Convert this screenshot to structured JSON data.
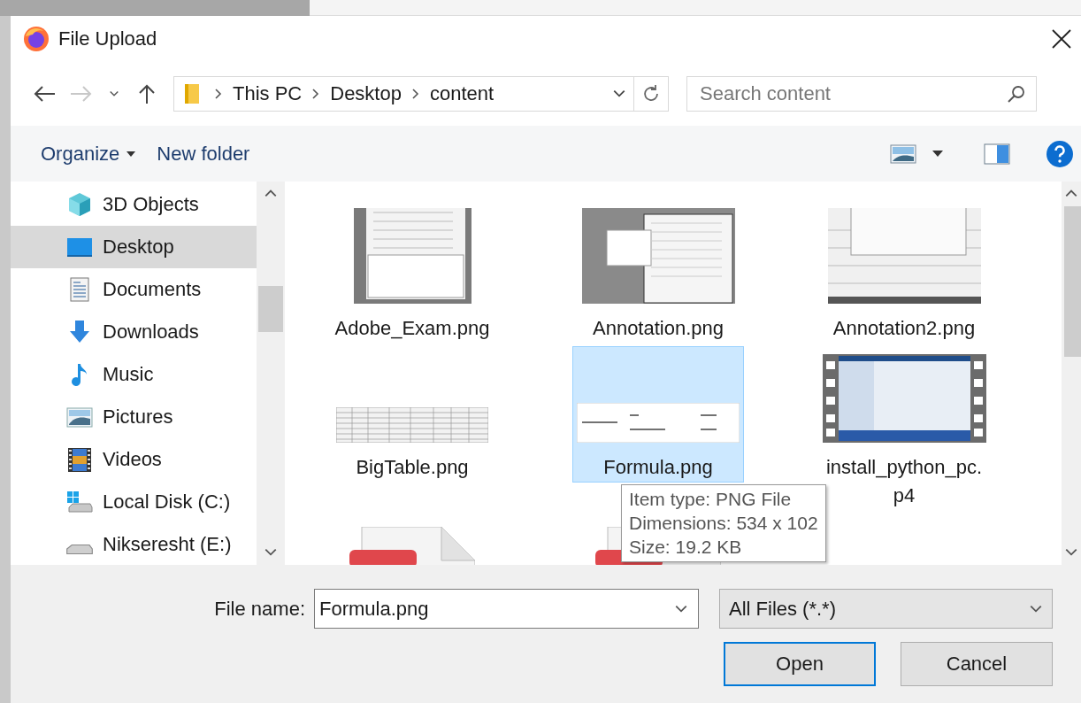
{
  "window": {
    "title": "File Upload"
  },
  "navigation": {
    "back_enabled": true,
    "forward_enabled": false,
    "path": [
      "This PC",
      "Desktop",
      "content"
    ],
    "search": {
      "placeholder": "Search content"
    }
  },
  "toolbar": {
    "organize": "Organize",
    "new_folder": "New folder"
  },
  "sidebar": {
    "items": [
      {
        "label": "3D Objects",
        "kind": "cube",
        "selected": false
      },
      {
        "label": "Desktop",
        "kind": "desktop",
        "selected": true
      },
      {
        "label": "Documents",
        "kind": "documents",
        "selected": false
      },
      {
        "label": "Downloads",
        "kind": "downloads",
        "selected": false
      },
      {
        "label": "Music",
        "kind": "music",
        "selected": false
      },
      {
        "label": "Pictures",
        "kind": "pictures",
        "selected": false
      },
      {
        "label": "Videos",
        "kind": "videos",
        "selected": false
      },
      {
        "label": "Local Disk (C:)",
        "kind": "system-drive",
        "selected": false
      },
      {
        "label": "Nikseresht (E:)",
        "kind": "drive",
        "selected": false
      }
    ]
  },
  "files": [
    {
      "name_lines": [
        "Adobe_Exam.png"
      ],
      "kind": "screenshot",
      "selected": false
    },
    {
      "name_lines": [
        "Annotation.png"
      ],
      "kind": "screenshot-wide",
      "selected": false
    },
    {
      "name_lines": [
        "Annotation2.png"
      ],
      "kind": "screenshot-dark",
      "selected": false
    },
    {
      "name_lines": [
        "BigTable.png"
      ],
      "kind": "table",
      "selected": false
    },
    {
      "name_lines": [
        "Formula.png"
      ],
      "kind": "formula",
      "selected": true
    },
    {
      "name_lines": [
        "install_python_pc.",
        "p4"
      ],
      "kind": "video",
      "selected": false
    },
    {
      "kind": "document",
      "selected": false
    },
    {
      "kind": "document",
      "selected": false
    }
  ],
  "tooltip": {
    "lines": [
      "Item type: PNG File",
      "Dimensions: 534 x 102",
      "Size: 19.2 KB"
    ]
  },
  "file_name": {
    "label": "File name:",
    "value": "Formula.png"
  },
  "file_type": {
    "value": "All Files (*.*)"
  },
  "buttons": [
    {
      "label": "Open",
      "default": true
    },
    {
      "label": "Cancel",
      "default": false
    }
  ]
}
